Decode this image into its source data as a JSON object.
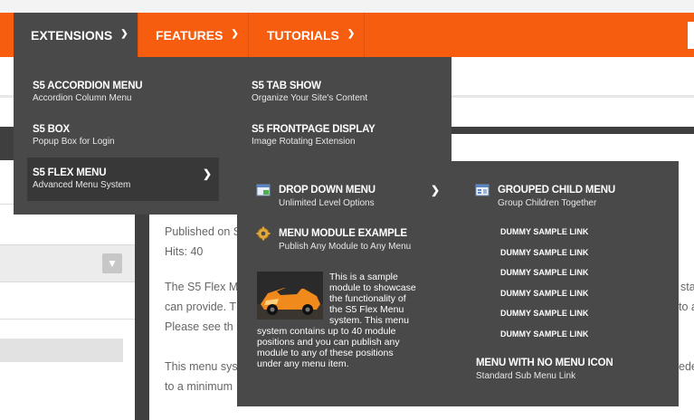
{
  "topnav": {
    "items": [
      {
        "label": "EXTENSIONS"
      },
      {
        "label": "FEATURES"
      },
      {
        "label": "TUTORIALS"
      }
    ]
  },
  "content": {
    "lines": [
      "Published on S",
      "Hits: 40",
      "The S5 Flex M",
      "can provide. T",
      "Please see th",
      "This menu sys",
      "to a minimum",
      "sta",
      "to a",
      "ede"
    ]
  },
  "extensions_menu": {
    "items": [
      {
        "title": "S5 ACCORDION MENU",
        "subtitle": "Accordion Column Menu"
      },
      {
        "title": "S5 TAB SHOW",
        "subtitle": "Organize Your Site's Content"
      },
      {
        "title": "S5 BOX",
        "subtitle": "Popup Box for Login"
      },
      {
        "title": "S5 FRONTPAGE DISPLAY",
        "subtitle": "Image Rotating Extension"
      },
      {
        "title": "S5 FLEX MENU",
        "subtitle": "Advanced Menu System"
      }
    ]
  },
  "flex_submenu": {
    "drop_down": {
      "title": "DROP DOWN MENU",
      "subtitle": "Unlimited Level Options"
    },
    "module_example": {
      "title": "MENU MODULE EXAMPLE",
      "subtitle": "Publish Any Module to Any Menu"
    },
    "description": [
      "This is a sample",
      "module to showcase",
      "the functionality of",
      "the S5 Flex Menu",
      "system. This menu",
      "system contains up to 40 module",
      "positions and you can publish any",
      "module to any of these positions",
      "under any menu item."
    ],
    "grouped": {
      "title": "GROUPED CHILD MENU",
      "subtitle": "Group Children Together"
    },
    "dummy_links": [
      "DUMMY SAMPLE LINK",
      "DUMMY SAMPLE LINK",
      "DUMMY SAMPLE LINK",
      "DUMMY SAMPLE LINK",
      "DUMMY SAMPLE LINK",
      "DUMMY SAMPLE LINK"
    ],
    "no_icon": {
      "title": "MENU WITH NO MENU ICON",
      "subtitle": "Standard Sub Menu Link"
    }
  },
  "colors": {
    "nav_orange": "#f65d0e",
    "menu_dark": "#494949",
    "menu_highlight": "#383838"
  }
}
